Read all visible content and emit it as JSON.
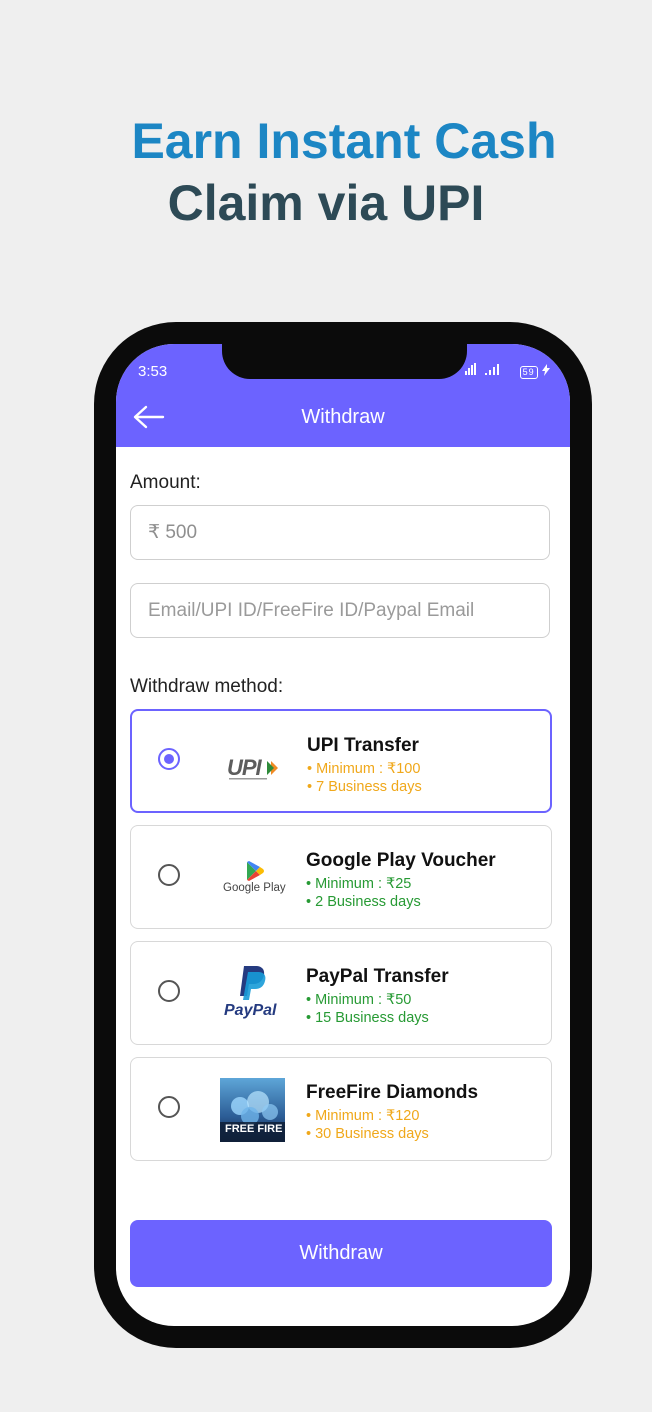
{
  "headline": {
    "line1": "Earn Instant Cash",
    "line2": "Claim via UPI",
    "line1_color": "#1c86c4",
    "line2_color": "#2d4a56"
  },
  "status_bar": {
    "time": "3:53",
    "signal_text": "²⁴ᴳıl .ıl",
    "battery": "59"
  },
  "app_bar": {
    "title": "Withdraw",
    "back_icon": "arrow-left-icon",
    "color": "#6c63ff"
  },
  "form": {
    "amount_label": "Amount:",
    "amount_value": "₹ 500",
    "id_placeholder": "Email/UPI ID/FreeFire ID/Paypal Email",
    "method_label": "Withdraw method:"
  },
  "methods": [
    {
      "title": "UPI Transfer",
      "minimum": "• Minimum : ₹100",
      "days": "• 7 Business days",
      "selected": true,
      "color": "#f0a81b",
      "logo": "upi-logo"
    },
    {
      "title": "Google Play Voucher",
      "minimum": "• Minimum : ₹25",
      "days": "• 2 Business days",
      "selected": false,
      "color": "#279a34",
      "logo": "google-play-logo",
      "logo_text": "Google Play"
    },
    {
      "title": "PayPal Transfer",
      "minimum": "• Minimum : ₹50",
      "days": "• 15 Business days",
      "selected": false,
      "color": "#279a34",
      "logo": "paypal-logo",
      "logo_text": "PayPal"
    },
    {
      "title": "FreeFire Diamonds",
      "minimum": "• Minimum : ₹120",
      "days": "• 30 Business days",
      "selected": false,
      "color": "#f0a81b",
      "logo": "freefire-logo",
      "logo_text": "FREE FIRE"
    }
  ],
  "submit": {
    "label": "Withdraw"
  }
}
